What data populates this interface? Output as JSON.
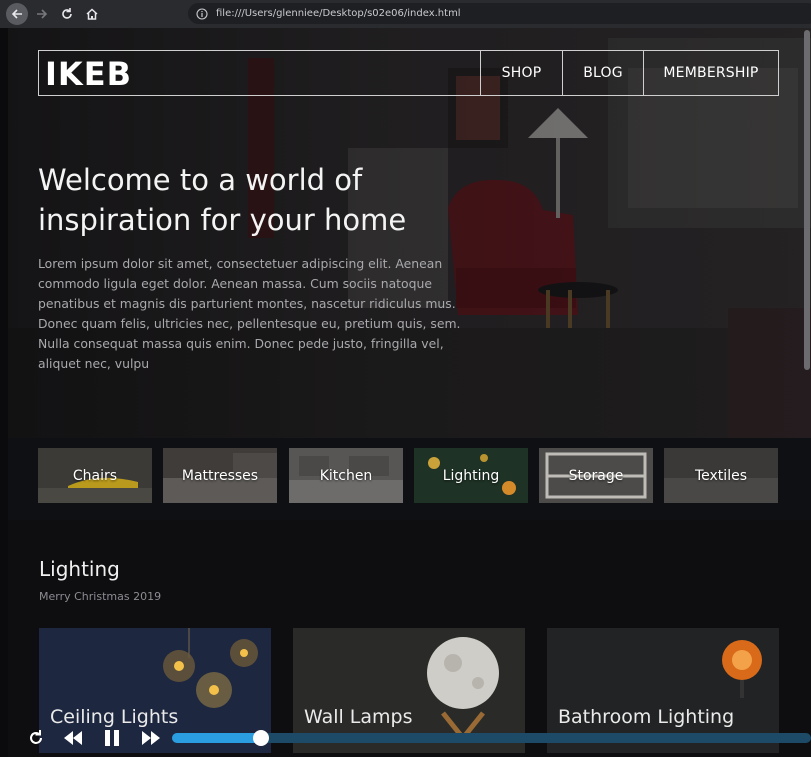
{
  "browser": {
    "url": "file:///Users/glenniee/Desktop/s02e06/index.html"
  },
  "site": {
    "logo_text": "IKEB",
    "nav": {
      "shop": "SHOP",
      "blog": "BLOG",
      "membership": "MEMBERSHIP"
    }
  },
  "hero": {
    "title": "Welcome to a world of inspiration for your home",
    "body": "Lorem ipsum dolor sit amet, consectetuer adipiscing elit. Aenean commodo ligula eget dolor. Aenean massa. Cum sociis natoque penatibus et magnis dis parturient montes, nascetur ridiculus mus. Donec quam felis, ultricies nec, pellentesque eu, pretium quis, sem. Nulla consequat massa quis enim. Donec pede justo, fringilla vel, aliquet nec, vulpu"
  },
  "categories": [
    "Chairs",
    "Mattresses",
    "Kitchen",
    "Lighting",
    "Storage",
    "Textiles"
  ],
  "section": {
    "title": "Lighting",
    "subtitle": "Merry Christmas 2019",
    "cards": [
      "Ceiling Lights",
      "Wall Lamps",
      "Bathroom Lighting"
    ]
  },
  "player": {
    "progress": 0.14
  },
  "colors": {
    "accent": "#2a9ee0",
    "track": "#1d4a66"
  },
  "icons": {
    "back": "arrow-left-icon",
    "forward": "arrow-right-icon",
    "reload": "reload-icon",
    "home": "home-icon",
    "info": "info-icon",
    "replay": "replay-icon",
    "rewind": "rewind-icon",
    "pause": "pause-icon",
    "fast_forward": "fast-forward-icon"
  }
}
